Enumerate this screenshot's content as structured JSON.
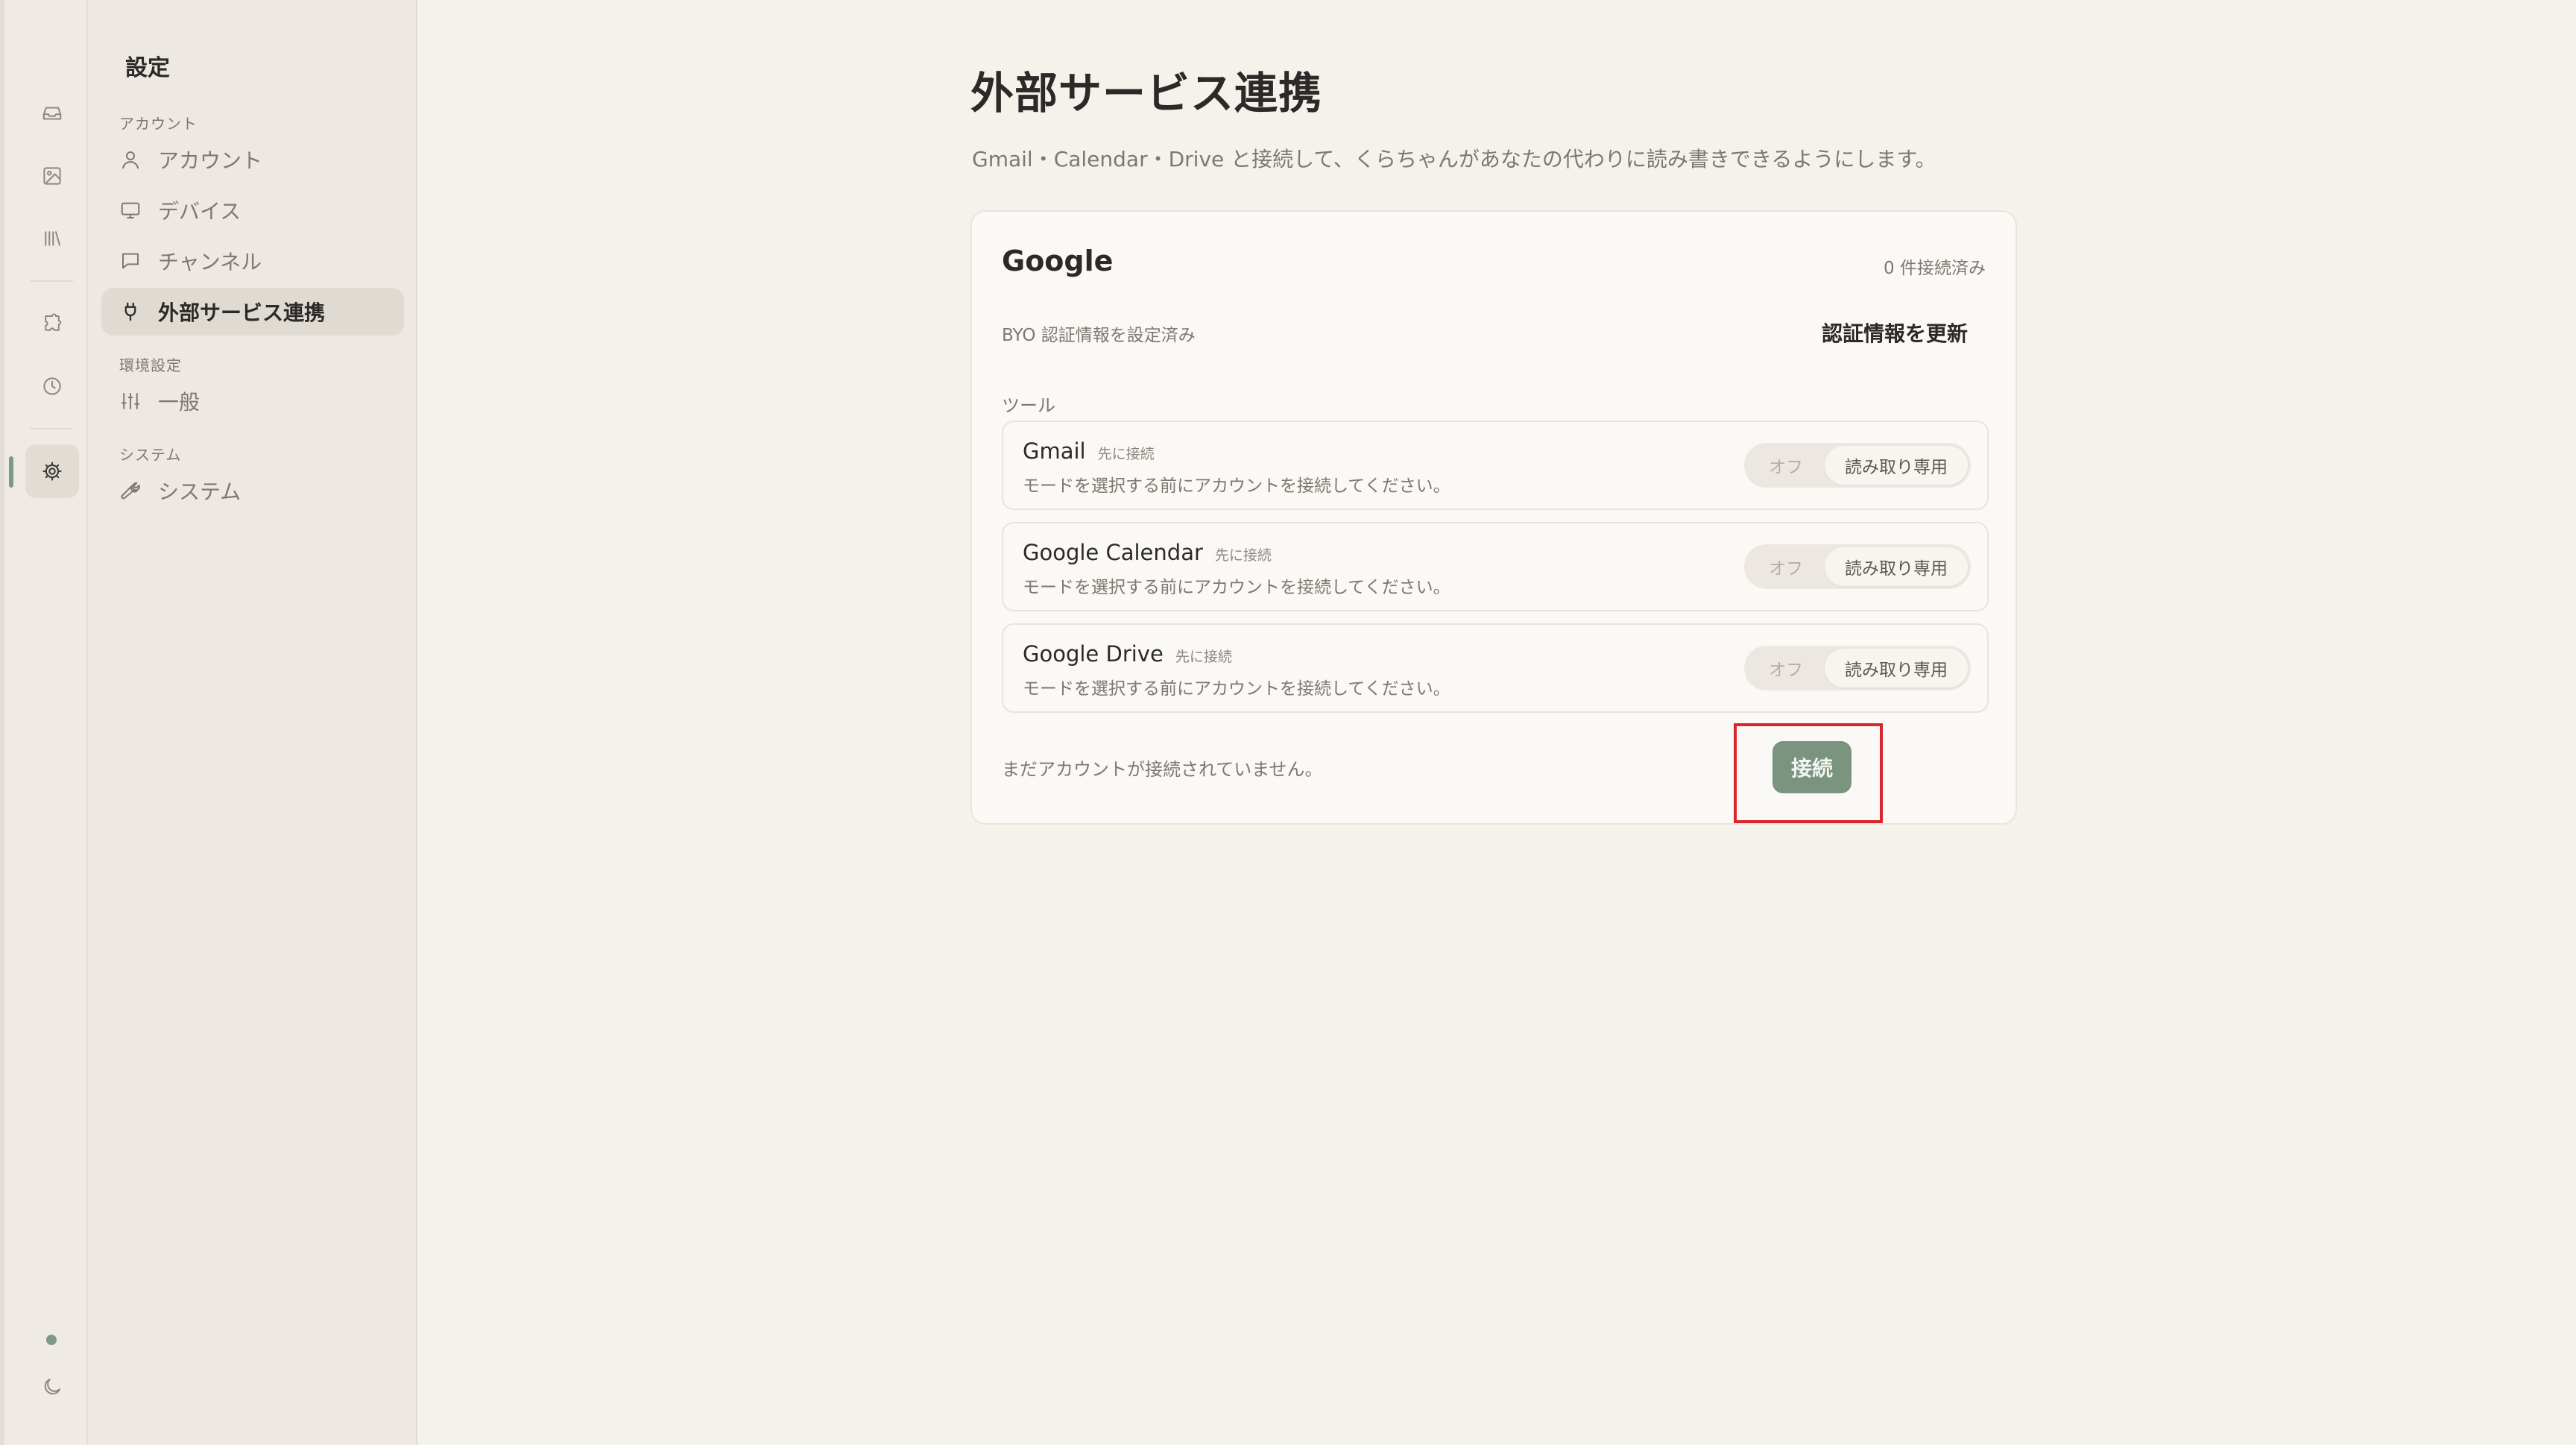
{
  "sidebar": {
    "title": "設定",
    "sections": {
      "account": "アカウント",
      "preferences": "環境設定",
      "system": "システム"
    },
    "items": [
      {
        "label": "アカウント",
        "icon": "user-icon"
      },
      {
        "label": "デバイス",
        "icon": "monitor-icon"
      },
      {
        "label": "チャンネル",
        "icon": "chat-icon"
      },
      {
        "label": "外部サービス連携",
        "icon": "plug-icon"
      },
      {
        "label": "一般",
        "icon": "sliders-icon"
      },
      {
        "label": "システム",
        "icon": "wrench-icon"
      }
    ],
    "active_index": 3
  },
  "rail": {
    "icons": [
      "inbox-icon",
      "image-icon",
      "library-icon",
      "puzzle-icon",
      "clock-icon",
      "gear-icon",
      "moon-icon"
    ]
  },
  "page": {
    "title": "外部サービス連携",
    "description": "Gmail・Calendar・Drive と接続して、くらちゃんがあなたの代わりに読み書きできるようにします。"
  },
  "card": {
    "title": "Google",
    "count": "0 件接続済み",
    "byo": "BYO 認証情報を設定済み",
    "update_label": "認証情報を更新",
    "tools_label": "ツール",
    "tools": [
      {
        "name": "Gmail",
        "badge": "先に接続",
        "desc": "モードを選択する前にアカウントを接続してください。",
        "off": "オフ",
        "read": "読み取り専用"
      },
      {
        "name": "Google Calendar",
        "badge": "先に接続",
        "desc": "モードを選択する前にアカウントを接続してください。",
        "off": "オフ",
        "read": "読み取り専用"
      },
      {
        "name": "Google Drive",
        "badge": "先に接続",
        "desc": "モードを選択する前にアカウントを接続してください。",
        "off": "オフ",
        "read": "読み取り専用"
      }
    ],
    "no_account": "まだアカウントが接続されていません。",
    "connect_label": "接続"
  },
  "colors": {
    "accent": "#7a9480",
    "highlight": "#d9262c",
    "background": "#f5f2ec"
  }
}
